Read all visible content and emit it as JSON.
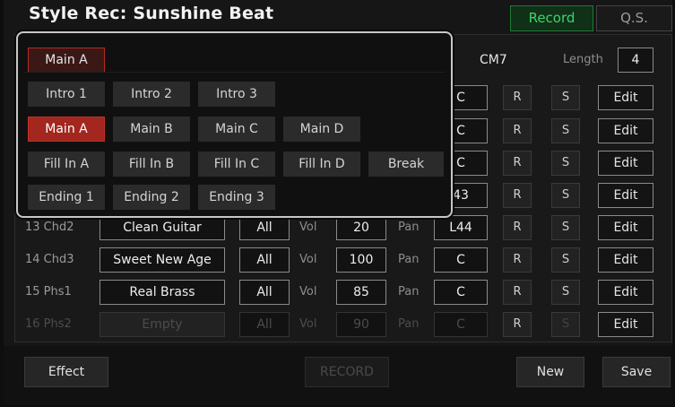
{
  "header": {
    "title": "Style Rec: Sunshine Beat",
    "tabs": [
      "Record",
      "Q.S."
    ],
    "active_tab": "Record"
  },
  "info": {
    "chord": "CM7",
    "length_label": "Length",
    "length_value": "4"
  },
  "tracks": [
    {
      "name": "",
      "voice": "",
      "part": "",
      "vol_label": "",
      "vol": "",
      "pan_label": "",
      "pan": "C",
      "r": "R",
      "s": "S",
      "edit": "Edit"
    },
    {
      "name": "",
      "voice": "",
      "part": "",
      "vol_label": "",
      "vol": "",
      "pan_label": "",
      "pan": "C",
      "r": "R",
      "s": "S",
      "edit": "Edit"
    },
    {
      "name": "",
      "voice": "",
      "part": "",
      "vol_label": "",
      "vol": "",
      "pan_label": "",
      "pan": "C",
      "r": "R",
      "s": "S",
      "edit": "Edit"
    },
    {
      "name": "",
      "voice": "",
      "part": "",
      "vol_label": "",
      "vol": "",
      "pan_label": "",
      "pan": "43",
      "r": "R",
      "s": "S",
      "edit": "Edit"
    },
    {
      "name": "13 Chd2",
      "voice": "Clean Guitar",
      "part": "All",
      "vol_label": "Vol",
      "vol": "20",
      "pan_label": "Pan",
      "pan": "L44",
      "r": "R",
      "s": "S",
      "edit": "Edit"
    },
    {
      "name": "14 Chd3",
      "voice": "Sweet New Age",
      "part": "All",
      "vol_label": "Vol",
      "vol": "100",
      "pan_label": "Pan",
      "pan": "C",
      "r": "R",
      "s": "S",
      "edit": "Edit"
    },
    {
      "name": "15 Phs1",
      "voice": "Real Brass",
      "part": "All",
      "vol_label": "Vol",
      "vol": "85",
      "pan_label": "Pan",
      "pan": "C",
      "r": "R",
      "s": "S",
      "edit": "Edit"
    },
    {
      "name": "16 Phs2",
      "voice": "Empty",
      "part": "All",
      "vol_label": "Vol",
      "vol": "90",
      "pan_label": "Pan",
      "pan": "C",
      "r": "R",
      "s": "S",
      "edit": "Edit"
    }
  ],
  "popup": {
    "current": "Main A",
    "rows": [
      [
        "Intro 1",
        "Intro 2",
        "Intro 3"
      ],
      [
        "Main A",
        "Main B",
        "Main C",
        "Main D"
      ],
      [
        "Fill In A",
        "Fill In B",
        "Fill In C",
        "Fill In D",
        "Break"
      ],
      [
        "Ending 1",
        "Ending 2",
        "Ending 3"
      ]
    ],
    "active": "Main A"
  },
  "bottom": {
    "effect": "Effect",
    "record": "RECORD",
    "new": "New",
    "save": "Save"
  },
  "colors": {
    "accent_green": "#3fd46a",
    "active_red": "#a3261f",
    "background": "#161616"
  }
}
